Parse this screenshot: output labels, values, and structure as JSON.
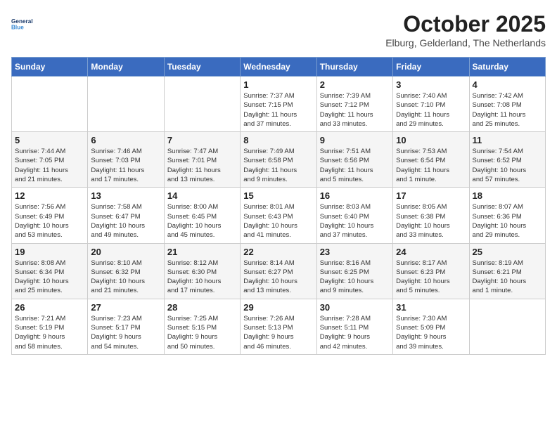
{
  "header": {
    "logo_line1": "General",
    "logo_line2": "Blue",
    "month_title": "October 2025",
    "location": "Elburg, Gelderland, The Netherlands"
  },
  "weekdays": [
    "Sunday",
    "Monday",
    "Tuesday",
    "Wednesday",
    "Thursday",
    "Friday",
    "Saturday"
  ],
  "weeks": [
    [
      {
        "day": "",
        "info": ""
      },
      {
        "day": "",
        "info": ""
      },
      {
        "day": "",
        "info": ""
      },
      {
        "day": "1",
        "info": "Sunrise: 7:37 AM\nSunset: 7:15 PM\nDaylight: 11 hours\nand 37 minutes."
      },
      {
        "day": "2",
        "info": "Sunrise: 7:39 AM\nSunset: 7:12 PM\nDaylight: 11 hours\nand 33 minutes."
      },
      {
        "day": "3",
        "info": "Sunrise: 7:40 AM\nSunset: 7:10 PM\nDaylight: 11 hours\nand 29 minutes."
      },
      {
        "day": "4",
        "info": "Sunrise: 7:42 AM\nSunset: 7:08 PM\nDaylight: 11 hours\nand 25 minutes."
      }
    ],
    [
      {
        "day": "5",
        "info": "Sunrise: 7:44 AM\nSunset: 7:05 PM\nDaylight: 11 hours\nand 21 minutes."
      },
      {
        "day": "6",
        "info": "Sunrise: 7:46 AM\nSunset: 7:03 PM\nDaylight: 11 hours\nand 17 minutes."
      },
      {
        "day": "7",
        "info": "Sunrise: 7:47 AM\nSunset: 7:01 PM\nDaylight: 11 hours\nand 13 minutes."
      },
      {
        "day": "8",
        "info": "Sunrise: 7:49 AM\nSunset: 6:58 PM\nDaylight: 11 hours\nand 9 minutes."
      },
      {
        "day": "9",
        "info": "Sunrise: 7:51 AM\nSunset: 6:56 PM\nDaylight: 11 hours\nand 5 minutes."
      },
      {
        "day": "10",
        "info": "Sunrise: 7:53 AM\nSunset: 6:54 PM\nDaylight: 11 hours\nand 1 minute."
      },
      {
        "day": "11",
        "info": "Sunrise: 7:54 AM\nSunset: 6:52 PM\nDaylight: 10 hours\nand 57 minutes."
      }
    ],
    [
      {
        "day": "12",
        "info": "Sunrise: 7:56 AM\nSunset: 6:49 PM\nDaylight: 10 hours\nand 53 minutes."
      },
      {
        "day": "13",
        "info": "Sunrise: 7:58 AM\nSunset: 6:47 PM\nDaylight: 10 hours\nand 49 minutes."
      },
      {
        "day": "14",
        "info": "Sunrise: 8:00 AM\nSunset: 6:45 PM\nDaylight: 10 hours\nand 45 minutes."
      },
      {
        "day": "15",
        "info": "Sunrise: 8:01 AM\nSunset: 6:43 PM\nDaylight: 10 hours\nand 41 minutes."
      },
      {
        "day": "16",
        "info": "Sunrise: 8:03 AM\nSunset: 6:40 PM\nDaylight: 10 hours\nand 37 minutes."
      },
      {
        "day": "17",
        "info": "Sunrise: 8:05 AM\nSunset: 6:38 PM\nDaylight: 10 hours\nand 33 minutes."
      },
      {
        "day": "18",
        "info": "Sunrise: 8:07 AM\nSunset: 6:36 PM\nDaylight: 10 hours\nand 29 minutes."
      }
    ],
    [
      {
        "day": "19",
        "info": "Sunrise: 8:08 AM\nSunset: 6:34 PM\nDaylight: 10 hours\nand 25 minutes."
      },
      {
        "day": "20",
        "info": "Sunrise: 8:10 AM\nSunset: 6:32 PM\nDaylight: 10 hours\nand 21 minutes."
      },
      {
        "day": "21",
        "info": "Sunrise: 8:12 AM\nSunset: 6:30 PM\nDaylight: 10 hours\nand 17 minutes."
      },
      {
        "day": "22",
        "info": "Sunrise: 8:14 AM\nSunset: 6:27 PM\nDaylight: 10 hours\nand 13 minutes."
      },
      {
        "day": "23",
        "info": "Sunrise: 8:16 AM\nSunset: 6:25 PM\nDaylight: 10 hours\nand 9 minutes."
      },
      {
        "day": "24",
        "info": "Sunrise: 8:17 AM\nSunset: 6:23 PM\nDaylight: 10 hours\nand 5 minutes."
      },
      {
        "day": "25",
        "info": "Sunrise: 8:19 AM\nSunset: 6:21 PM\nDaylight: 10 hours\nand 1 minute."
      }
    ],
    [
      {
        "day": "26",
        "info": "Sunrise: 7:21 AM\nSunset: 5:19 PM\nDaylight: 9 hours\nand 58 minutes."
      },
      {
        "day": "27",
        "info": "Sunrise: 7:23 AM\nSunset: 5:17 PM\nDaylight: 9 hours\nand 54 minutes."
      },
      {
        "day": "28",
        "info": "Sunrise: 7:25 AM\nSunset: 5:15 PM\nDaylight: 9 hours\nand 50 minutes."
      },
      {
        "day": "29",
        "info": "Sunrise: 7:26 AM\nSunset: 5:13 PM\nDaylight: 9 hours\nand 46 minutes."
      },
      {
        "day": "30",
        "info": "Sunrise: 7:28 AM\nSunset: 5:11 PM\nDaylight: 9 hours\nand 42 minutes."
      },
      {
        "day": "31",
        "info": "Sunrise: 7:30 AM\nSunset: 5:09 PM\nDaylight: 9 hours\nand 39 minutes."
      },
      {
        "day": "",
        "info": ""
      }
    ]
  ]
}
